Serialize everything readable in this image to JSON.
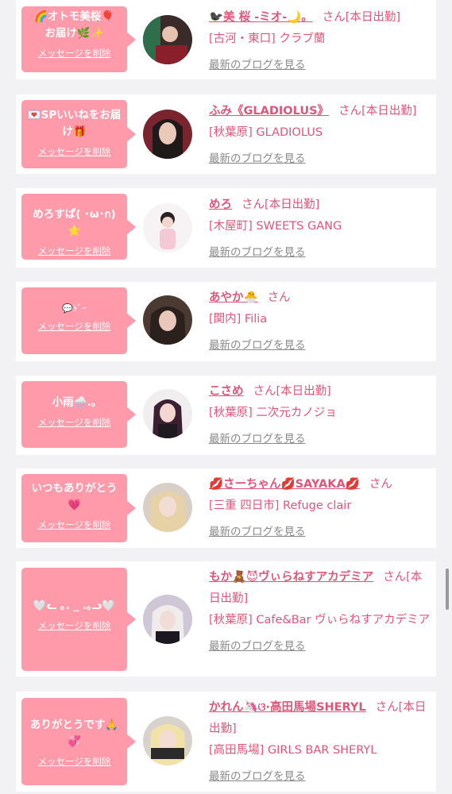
{
  "colors": {
    "accent_pink": "#e0567a",
    "bubble_pink": "#ff9aab",
    "background": "#f2f2f4",
    "link_gray": "#8a8a8a"
  },
  "cards": [
    {
      "message": "🌈オトモ美桜🎈\nお届け🌿✨",
      "delete_label": "メッセージを削除",
      "name": "🐦‍⬛美 桜 -ミオ-🌙。",
      "honorific": "さん",
      "status": "[本日出勤]",
      "shop": "[古河・東口] クラブ蘭",
      "blog_label": "最新のブログを見る",
      "avatar_icon": "avatar-photo-icon"
    },
    {
      "message": "💌SPいいねをお届け🎁",
      "delete_label": "メッセージを削除",
      "name": "ふみ《GLADIOLUS》",
      "honorific": "さん",
      "status": "[本日出勤]",
      "shop": "[秋葉原] GLADIOLUS",
      "blog_label": "最新のブログを見る",
      "avatar_icon": "avatar-photo-icon"
    },
    {
      "message": "めろすぱ( ･ω･ก)⭐",
      "delete_label": "メッセージを削除",
      "name": "めろ",
      "honorific": "さん",
      "status": "[本日出勤]",
      "shop": "[木屋町] SWEETS GANG",
      "blog_label": "最新のブログを見る",
      "avatar_icon": "avatar-photo-icon"
    },
    {
      "message": "💬ﾄﾞｰ",
      "delete_label": "メッセージを削除",
      "name": "あやか🐣",
      "honorific": "さん",
      "status": "",
      "shop": "[関内] Filia",
      "blog_label": "最新のブログを見る",
      "avatar_icon": "avatar-photo-icon"
    },
    {
      "message": "小雨🌧️.｡",
      "delete_label": "メッセージを削除",
      "name": "こさめ",
      "honorific": "さん",
      "status": "[本日出勤]",
      "shop": "[秋葉原] 二次元カノジョ",
      "blog_label": "最新のブログを見る",
      "avatar_icon": "avatar-photo-icon"
    },
    {
      "message": "いつもありがとう💗",
      "delete_label": "メッセージを削除",
      "name": "💋さーちゃん💋SAYAKA💋",
      "honorific": "さん",
      "status": "",
      "shop": "[三重 四日市] Refuge clair",
      "blog_label": "最新のブログを見る",
      "avatar_icon": "avatar-photo-icon"
    },
    {
      "message": "🤍ᓚ ｡. _ .｡ᓗ🤍",
      "delete_label": "メッセージを削除",
      "name": "もか🧸😈ヴぃらねすアカデミア",
      "honorific": "さん",
      "status": "[本日出勤]",
      "shop": "[秋葉原] Cafe&Bar ヴぃらねすアカデミア",
      "blog_label": "最新のブログを見る",
      "avatar_icon": "avatar-photo-icon"
    },
    {
      "message": "ありがとうです🙏💞",
      "delete_label": "メッセージを削除",
      "name": "かれん🦄ଓ·高田馬場SHERYL",
      "honorific": "さん",
      "status": "[本日出勤]",
      "shop": "[高田馬場] GIRLS BAR SHERYL",
      "blog_label": "最新のブログを見る",
      "avatar_icon": "avatar-photo-icon"
    }
  ]
}
